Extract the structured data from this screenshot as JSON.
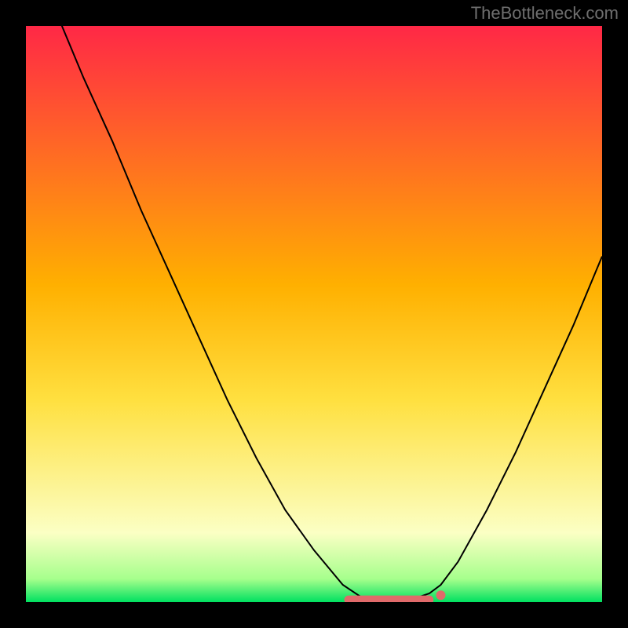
{
  "watermark": "TheBottleneck.com",
  "colors": {
    "frame_bg": "#000000",
    "grad_top": "#ff2846",
    "grad_yellow": "#ffe040",
    "grad_pale": "#fbffc4",
    "grad_bottom": "#00e060",
    "curve": "#000000",
    "marker_stroke": "#e06a6a",
    "marker_fill": "#e06a6a"
  },
  "chart_data": {
    "type": "line",
    "title": "",
    "xlabel": "",
    "ylabel": "",
    "xlim": [
      0,
      100
    ],
    "ylim": [
      0,
      100
    ],
    "series": [
      {
        "name": "bottleneck_curve",
        "x": [
          0,
          5,
          10,
          15,
          20,
          25,
          30,
          35,
          40,
          45,
          50,
          55,
          58,
          60,
          62,
          65,
          68,
          70,
          72,
          75,
          80,
          85,
          90,
          95,
          100
        ],
        "y": [
          115,
          103,
          91,
          80,
          68,
          57,
          46,
          35,
          25,
          16,
          9,
          3,
          1,
          0.5,
          0.3,
          0.3,
          0.8,
          1.5,
          3,
          7,
          16,
          26,
          37,
          48,
          60
        ]
      }
    ],
    "highlight_band": {
      "x_start": 56,
      "x_end": 70,
      "y": 0.4
    },
    "highlight_dot": {
      "x": 72,
      "y": 1.2
    },
    "gradient_stops": [
      {
        "pct": 0,
        "color": "#ff2846"
      },
      {
        "pct": 45,
        "color": "#ffb000"
      },
      {
        "pct": 65,
        "color": "#ffe040"
      },
      {
        "pct": 88,
        "color": "#fbffc4"
      },
      {
        "pct": 96,
        "color": "#a6ff8c"
      },
      {
        "pct": 100,
        "color": "#00e060"
      }
    ]
  }
}
